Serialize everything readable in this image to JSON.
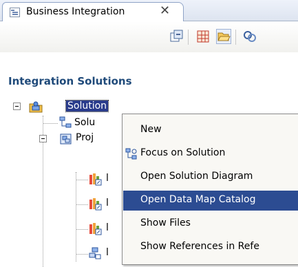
{
  "view": {
    "tab_title": "Business Integration",
    "close_glyph": "✕"
  },
  "toolbar": {
    "buttons": [
      "collapse-all-icon",
      "grid-icon",
      "folder-open-icon",
      "refresh-icon"
    ]
  },
  "panel": {
    "title": "Integration Solutions"
  },
  "tree": {
    "root_label": "Solution",
    "items": [
      {
        "label": "Solu",
        "icon": "solution-diagram-icon"
      },
      {
        "label": "Proj",
        "icon": "project-icon"
      },
      {
        "label": "l",
        "icon": "data-map-icon"
      },
      {
        "label": "l",
        "icon": "data-map-icon"
      },
      {
        "label": "l",
        "icon": "data-map-icon"
      },
      {
        "label": "l",
        "icon": "interface-icon"
      }
    ]
  },
  "context_menu": {
    "items": [
      {
        "label": "New",
        "icon": ""
      },
      {
        "label": "Focus on Solution",
        "icon": "focus-icon"
      },
      {
        "label": "Open Solution Diagram",
        "icon": ""
      },
      {
        "label": "Open Data Map Catalog",
        "icon": "",
        "highlighted": true
      },
      {
        "label": "Show Files",
        "icon": ""
      },
      {
        "label": "Show References in Refe",
        "icon": ""
      }
    ]
  }
}
